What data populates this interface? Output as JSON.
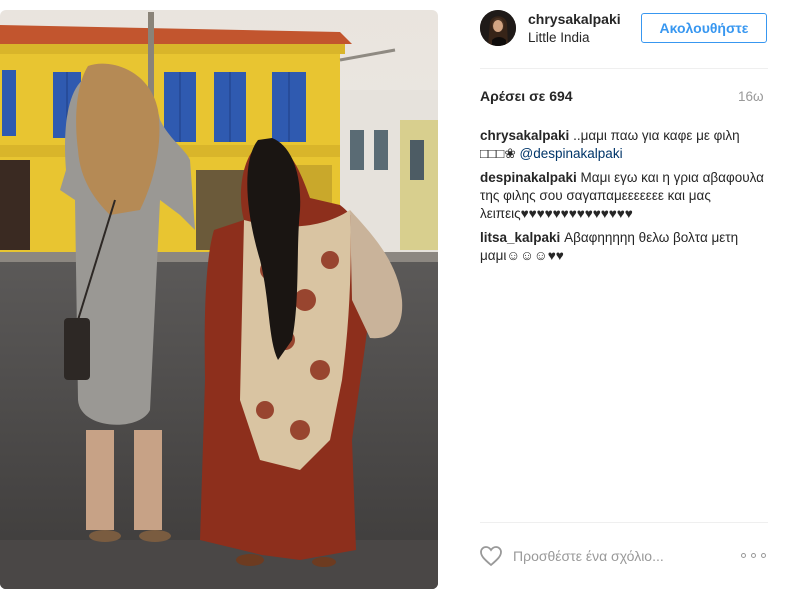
{
  "post": {
    "username": "chrysakalpaki",
    "location": "Little India",
    "follow_label": "Ακολουθήστε",
    "likes_text": "Αρέσει σε 694",
    "time_ago": "16ω",
    "photo_alt": "Two women standing at a street crossing in front of a yellow building with blue shutters"
  },
  "comments": [
    {
      "user": "chrysakalpaki",
      "text": " ..μαμι παω για καφε με φιλη ",
      "emoji": "□□□❀",
      "mention": "@despinakalpaki"
    },
    {
      "user": "despinakalpaki",
      "text": " Μαμι εγω και η γρια αβαφουλα της φιλης σου σαγαπαμεεεεεεε και μας λειπεις♥♥♥♥♥♥♥♥♥♥♥♥♥♥"
    },
    {
      "user": "litsa_kalpaki",
      "text": " Αβαφηηηηη θελω βολτα μετη μαμι☺☺☺♥♥"
    }
  ],
  "comment_box": {
    "placeholder": "Προσθέστε ένα σχόλιο..."
  },
  "colors": {
    "accent": "#3897f0",
    "mention": "#003569",
    "muted": "#999999"
  }
}
